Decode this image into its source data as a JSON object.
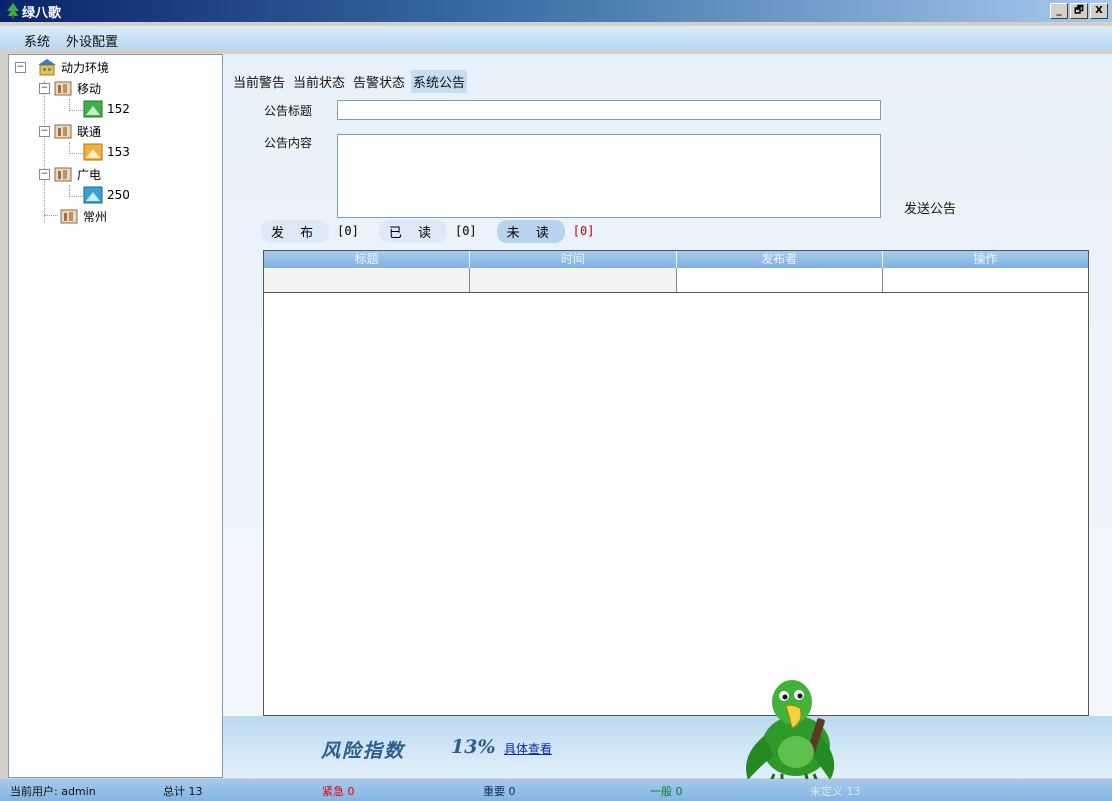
{
  "window": {
    "title": "绿八歌",
    "buttons": [
      "_",
      "🗗",
      "X"
    ]
  },
  "menu": {
    "items": [
      "系统",
      "外设配置"
    ]
  },
  "tree": {
    "root": "动力环境",
    "groups": [
      {
        "label": "移动",
        "child": "152"
      },
      {
        "label": "联通",
        "child": "153"
      },
      {
        "label": "广电",
        "child": "250"
      }
    ],
    "leaf": "常州"
  },
  "tabs": [
    "当前警告",
    "当前状态",
    "告警状态",
    "系统公告"
  ],
  "form": {
    "title_label": "公告标题",
    "title_value": "",
    "content_label": "公告内容",
    "content_value": "",
    "send_label": "发送公告"
  },
  "filters": [
    {
      "label": "发 布",
      "count": "[0]"
    },
    {
      "label": "已 读",
      "count": "[0]"
    },
    {
      "label": "未 读",
      "count": "[0]"
    }
  ],
  "table": {
    "columns": [
      "标题",
      "时间",
      "发布者",
      "操作"
    ]
  },
  "risk": {
    "label": "风险指数",
    "value": "13%",
    "link": "具体查看"
  },
  "status": {
    "user": "当前用户: admin",
    "total": "总计 13",
    "urgent": "紧急 0",
    "important": "重要 0",
    "general": "一般 0",
    "undefined": "未定义 13"
  },
  "colors": {
    "urgent": "#e00000",
    "important": "#1a2a5a",
    "general": "#0a7a30",
    "undefined": "#dbe8f5"
  }
}
